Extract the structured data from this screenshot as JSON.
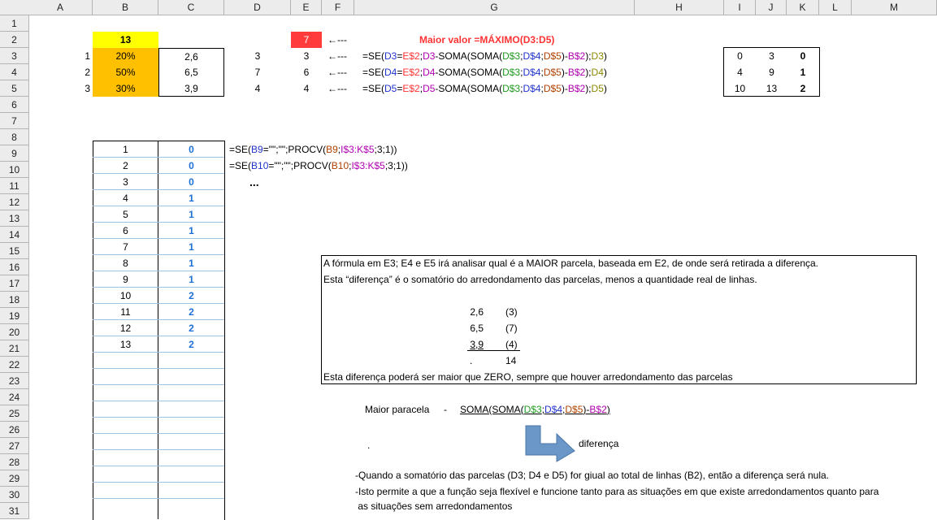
{
  "columns": [
    "A",
    "B",
    "C",
    "D",
    "E",
    "F",
    "G",
    "H",
    "I",
    "J",
    "K",
    "L",
    "M"
  ],
  "rows": [
    "1",
    "2",
    "3",
    "4",
    "5",
    "6",
    "7",
    "8",
    "9",
    "10",
    "11",
    "12",
    "13",
    "14",
    "15",
    "16",
    "17",
    "18",
    "19",
    "20",
    "21",
    "22",
    "23",
    "24",
    "25",
    "26",
    "27",
    "28",
    "29",
    "30",
    "31"
  ],
  "top": {
    "b2": "13",
    "e2": "7",
    "arrow": "←---",
    "maior_valor": "Maior valor =MÁXIMO(D3:D5)",
    "a_vals": [
      "1",
      "2",
      "3"
    ],
    "b_vals": [
      "20%",
      "50%",
      "30%"
    ],
    "c_vals": [
      "2,6",
      "6,5",
      "3,9"
    ],
    "d_vals": [
      "3",
      "7",
      "4"
    ],
    "e_vals": [
      "3",
      "6",
      "4"
    ]
  },
  "formulas_g": [
    [
      "=SE(",
      "D3",
      "=",
      "E$2",
      ";",
      "D3",
      "-SOMA(SOMA(",
      "D$3",
      ";",
      "D$4",
      ";",
      "D$5",
      ")-",
      "B$2",
      ");",
      "D3",
      ")"
    ],
    [
      "=SE(",
      "D4",
      "=",
      "E$2",
      ";",
      "D4",
      "-SOMA(SOMA(",
      "D$3",
      ";",
      "D$4",
      ";",
      "D$5",
      ")-",
      "B$2",
      ");",
      "D4",
      ")"
    ],
    [
      "=SE(",
      "D5",
      "=",
      "E$2",
      ";",
      "D5",
      "-SOMA(SOMA(",
      "D$3",
      ";",
      "D$4",
      ";",
      "D$5",
      ")-",
      "B$2",
      ");",
      "D5",
      ")"
    ]
  ],
  "lookup_table": [
    [
      "0",
      "3",
      "0"
    ],
    [
      "4",
      "9",
      "1"
    ],
    [
      "10",
      "13",
      "2"
    ]
  ],
  "list": {
    "b": [
      "1",
      "2",
      "3",
      "4",
      "5",
      "6",
      "7",
      "8",
      "9",
      "10",
      "11",
      "12",
      "13"
    ],
    "c": [
      "0",
      "0",
      "0",
      "1",
      "1",
      "1",
      "1",
      "1",
      "1",
      "2",
      "2",
      "2",
      "2"
    ]
  },
  "procv": [
    [
      "=SE(",
      "B9",
      "=\"\";\"\";PROCV(",
      "B9",
      ";",
      "I$3:K$5",
      ";3;1))"
    ],
    [
      "=SE(",
      "B10",
      "=\"\";\"\";PROCV(",
      "B10",
      ";",
      "I$3:K$5",
      ";3;1))"
    ]
  ],
  "ellipsis": "...",
  "note_box": {
    "line1": "A fórmula em E3; E4 e E5 irá analisar qual é a MAIOR parcela, baseada em E2, de onde será retirada a diferença.",
    "line2": "Esta “diferença” é o somatório do arredondamento das parcelas, menos a quantidade real de linhas.",
    "vals": [
      "2,6",
      "6,5",
      "3,9"
    ],
    "rounded": [
      "(3)",
      "(7)",
      "(4)"
    ],
    "dot": ".",
    "total": "14",
    "line_last": "Esta diferença poderá ser maior que ZERO, sempre que houver arredondamento das parcelas"
  },
  "maior_parcela": {
    "label": "Maior paracela",
    "dash": "-",
    "formula": [
      "SOMA(SOMA(",
      "D$3",
      ";",
      "D$4",
      ";",
      "D$5",
      ")-",
      "B$2",
      ")"
    ],
    "dot": ".",
    "arrow_label": "diferença"
  },
  "notes": [
    "-Quando a somatório das parcelas (D3; D4 e D5) for giual ao total de linhas (B2), então a diferença será nula.",
    "-Isto permite a que a função seja flexível e funcione tanto para as situações em que existe arredondamentos quanto para",
    " as situações sem arredondamentos"
  ],
  "colors": {
    "yellow": "#ffff00",
    "orange": "#ffc000",
    "red": "#ff3b3b",
    "blue_value": "#1f6fd6",
    "arrow_fill": "#6b96c8"
  }
}
